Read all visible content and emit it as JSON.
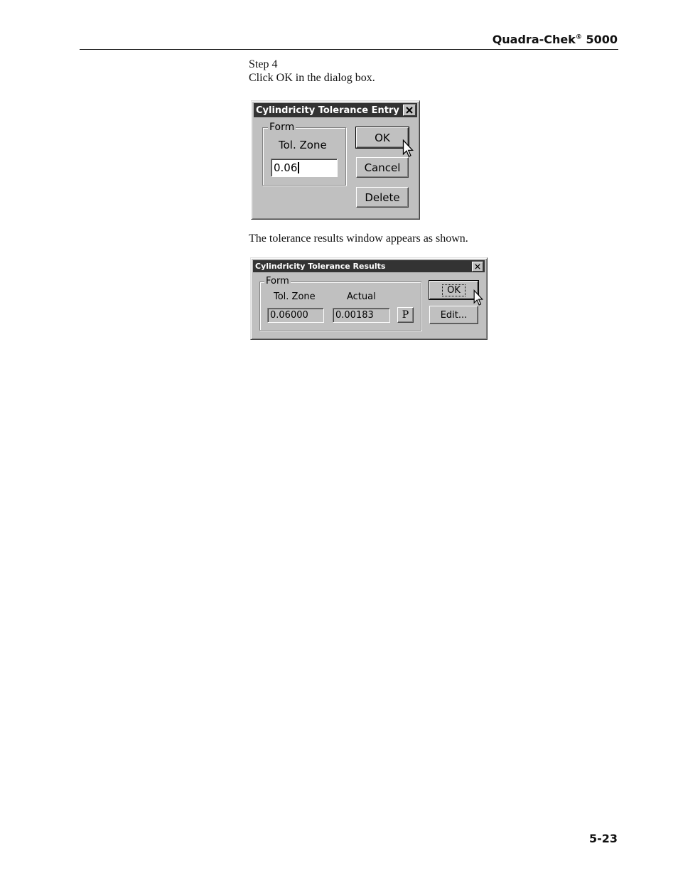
{
  "header": {
    "title": "Quadra-Chek",
    "registered_mark": "®",
    "model": "5000"
  },
  "step_label": "Step 4",
  "instruction": "Click OK in the dialog box.",
  "entry_dialog": {
    "title": "Cylindricity Tolerance Entry",
    "group_label": "Form",
    "tol_zone_label": "Tol. Zone",
    "tol_zone_value": "0.06",
    "ok_label": "OK",
    "cancel_label": "Cancel",
    "delete_label": "Delete"
  },
  "result_text": "The tolerance results window appears as shown.",
  "results_dialog": {
    "title": "Cylindricity Tolerance Results",
    "group_label": "Form",
    "tol_zone_label": "Tol. Zone",
    "actual_label": "Actual",
    "tol_zone_value": "0.06000",
    "actual_value": "0.00183",
    "status_value": "P",
    "ok_label": "OK",
    "edit_label": "Edit..."
  },
  "page_number": "5-23"
}
